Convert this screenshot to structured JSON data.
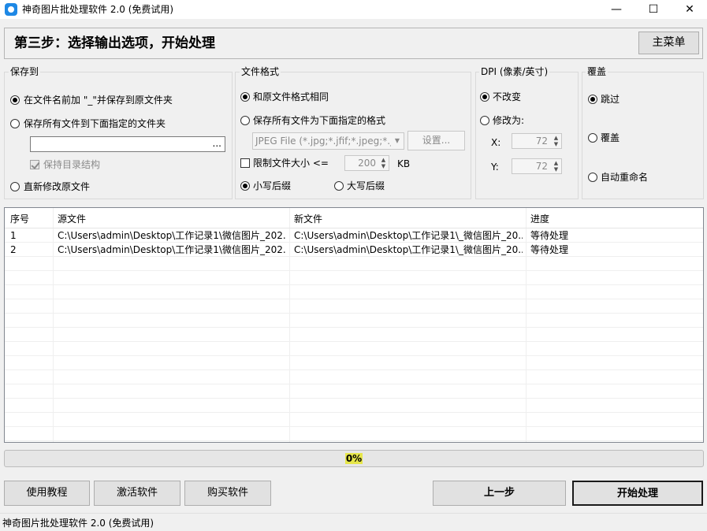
{
  "window": {
    "title": "神奇图片批处理软件 2.0 (免费试用)",
    "minimize": "—",
    "maximize": "☐",
    "close": "✕"
  },
  "header": {
    "step_title": "第三步：选择输出选项，开始处理",
    "main_menu_label": "主菜单"
  },
  "save_to": {
    "title": "保存到",
    "option_prefix": "在文件名前加 \"_\"并保存到原文件夹",
    "option_folder": "保存所有文件到下面指定的文件夹",
    "folder_value": "",
    "browse_label": "...",
    "keep_structure": "保持目录结构",
    "option_overwrite": "直新修改原文件",
    "selected": "option_prefix"
  },
  "file_format": {
    "title": "文件格式",
    "option_same": "和原文件格式相同",
    "option_specified": "保存所有文件为下面指定的格式",
    "format_value": "JPEG File (*.jpg;*.jfif;*.jpeg;*.j",
    "settings_label": "设置...",
    "limit_size_label": "限制文件大小 <=",
    "limit_value": "200",
    "limit_unit": "KB",
    "lower_ext": "小写后缀",
    "upper_ext": "大写后缀",
    "selected": "option_same",
    "ext_selected": "lower_ext"
  },
  "dpi": {
    "title": "DPI (像素/英寸)",
    "option_keep": "不改变",
    "option_change": "修改为:",
    "x_label": "X:",
    "x_value": "72",
    "y_label": "Y:",
    "y_value": "72",
    "selected": "option_keep"
  },
  "overwrite": {
    "title": "覆盖",
    "option_skip": "跳过",
    "option_overwrite": "覆盖",
    "option_rename": "自动重命名",
    "selected": "option_skip"
  },
  "table": {
    "columns": [
      "序号",
      "源文件",
      "新文件",
      "进度"
    ],
    "rows": [
      [
        "1",
        "C:\\Users\\admin\\Desktop\\工作记录1\\微信图片_202...",
        "C:\\Users\\admin\\Desktop\\工作记录1\\_微信图片_20...",
        "等待处理"
      ],
      [
        "2",
        "C:\\Users\\admin\\Desktop\\工作记录1\\微信图片_202...",
        "C:\\Users\\admin\\Desktop\\工作记录1\\_微信图片_20...",
        "等待处理"
      ]
    ]
  },
  "progress": {
    "value": 0,
    "label": "0%"
  },
  "buttons": {
    "tutorial": "使用教程",
    "activate": "激活软件",
    "buy": "购买软件",
    "prev": "上一步",
    "start": "开始处理"
  },
  "status_bar": {
    "text": "神奇图片批处理软件 2.0 (免费试用)"
  }
}
